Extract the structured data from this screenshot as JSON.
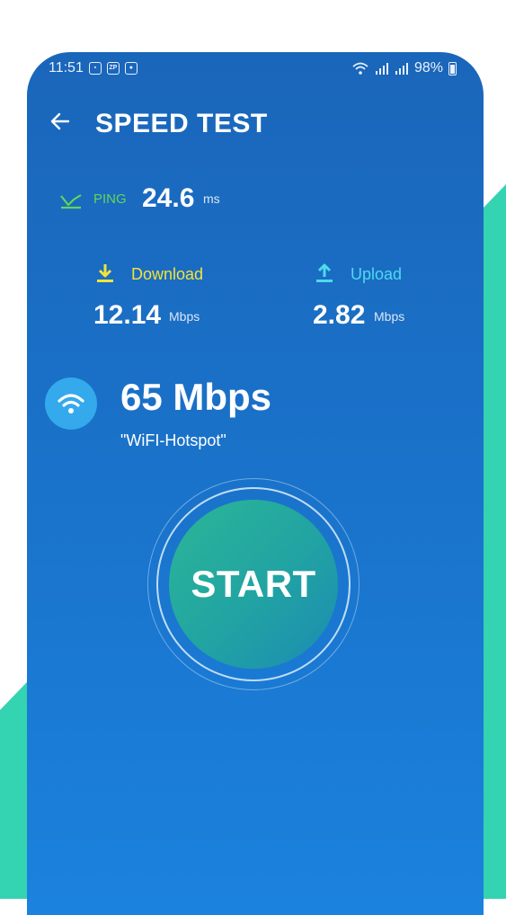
{
  "status_bar": {
    "time": "11:51",
    "icons": [
      "image-icon",
      "zp-icon",
      "camera-icon"
    ],
    "zp_text": "ZP",
    "battery": "98%"
  },
  "app_bar": {
    "title": "SPEED TEST",
    "back_icon": "arrow-left-icon"
  },
  "ping": {
    "label": "PING",
    "value": "24.6",
    "unit": "ms",
    "color": "#5fd75a"
  },
  "download": {
    "label": "Download",
    "value": "12.14",
    "unit": "Mbps",
    "color": "#f3e33a"
  },
  "upload": {
    "label": "Upload",
    "value": "2.82",
    "unit": "Mbps",
    "color": "#4fd9ef"
  },
  "wifi": {
    "speed": "65 Mbps",
    "ssid": "\"WiFI-Hotspot\""
  },
  "start_button": {
    "label": "START"
  },
  "colors": {
    "accent_teal": "#34d3b1",
    "background_blue": "#1a6fc6"
  }
}
